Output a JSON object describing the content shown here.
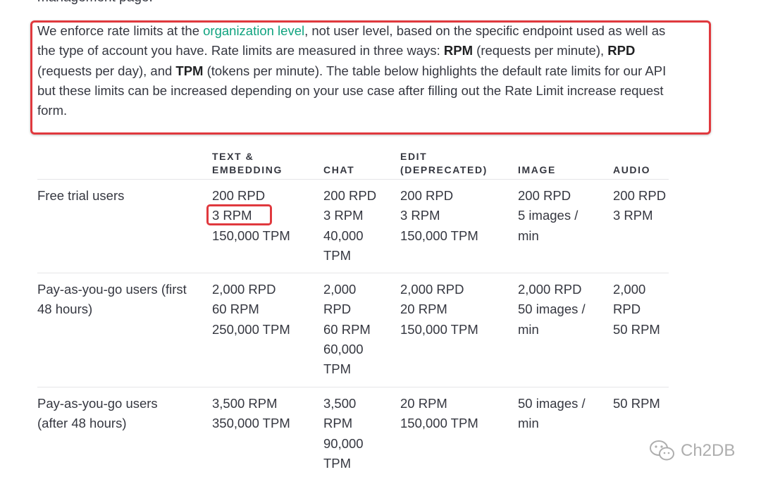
{
  "cut_heading": "management page.",
  "intro": {
    "t1": "We enforce rate limits at the ",
    "link": "organization level",
    "t2": ", not user level, based on the specific endpoint used as well as the type of account you have. Rate limits are measured in three ways: ",
    "b1": "RPM",
    "t3": " (requests per minute), ",
    "b2": "RPD",
    "t4": " (requests per day), and ",
    "b3": "TPM",
    "t5": " (tokens per minute). The table below highlights the default rate limits for our API but these limits can be increased depending on your use case after filling out the Rate Limit increase request form."
  },
  "table": {
    "headers": [
      [
        "TEXT &",
        "EMBEDDING"
      ],
      [
        "CHAT"
      ],
      [
        "EDIT",
        "(DEPRECATED)"
      ],
      [
        "IMAGE"
      ],
      [
        "AUDIO"
      ]
    ],
    "rows": [
      {
        "label": [
          "Free trial users"
        ],
        "cells": [
          [
            "200 RPD",
            "3 RPM",
            "150,000 TPM"
          ],
          [
            "200 RPD",
            "3 RPM",
            "40,000",
            "TPM"
          ],
          [
            "200 RPD",
            "3 RPM",
            "150,000 TPM"
          ],
          [
            "200 RPD",
            "5 images /",
            "min"
          ],
          [
            "200 RPD",
            "3 RPM"
          ]
        ]
      },
      {
        "label": [
          "Pay-as-you-go users (first",
          "48 hours)"
        ],
        "cells": [
          [
            "2,000 RPD",
            "60 RPM",
            "250,000 TPM"
          ],
          [
            "2,000",
            "RPD",
            "60 RPM",
            "60,000",
            "TPM"
          ],
          [
            "2,000 RPD",
            "20 RPM",
            "150,000 TPM"
          ],
          [
            "2,000 RPD",
            "50 images /",
            "min"
          ],
          [
            "2,000",
            "RPD",
            "50 RPM"
          ]
        ]
      },
      {
        "label": [
          "Pay-as-you-go users",
          "(after 48 hours)"
        ],
        "cells": [
          [
            "3,500 RPM",
            "350,000 TPM"
          ],
          [
            "3,500",
            "RPM",
            "90,000",
            "TPM"
          ],
          [
            "20 RPM",
            "150,000 TPM"
          ],
          [
            "50 images /",
            "min"
          ],
          [
            "50 RPM"
          ]
        ]
      }
    ]
  },
  "watermark": "Ch2DB",
  "colors": {
    "link": "#10a37f",
    "highlight_border": "#e0393e",
    "text": "#353740"
  }
}
